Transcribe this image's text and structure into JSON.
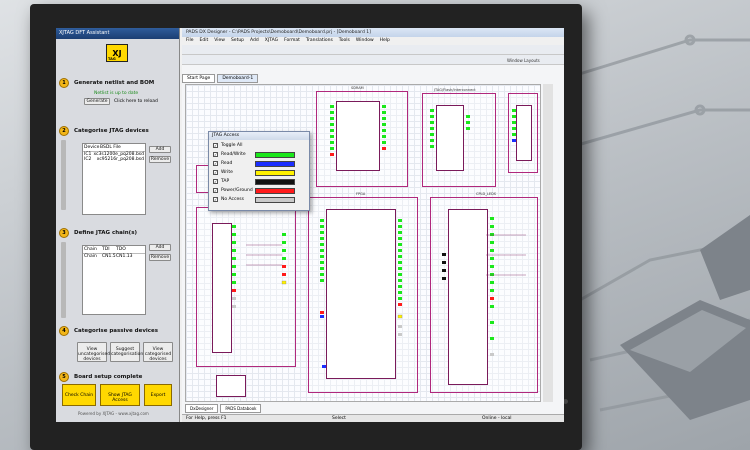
{
  "assistant": {
    "title": "XJTAG DFT Assistant",
    "logo_top": "XJ",
    "logo_bottom": "TAG",
    "steps": [
      {
        "num": "1",
        "title": "Generate netlist and BOM",
        "status": "Netlist is up to date",
        "button": "Generate",
        "hint": "Click here to reload"
      },
      {
        "num": "2",
        "title": "Categorise JTAG devices",
        "col1": "Device",
        "col2": "BSDL File",
        "rows": [
          [
            "IC1",
            "xc3s1200e_pq208.bsd"
          ],
          [
            "IC2",
            "xc95216r_pq208.bsd"
          ]
        ],
        "add": "Add",
        "remove": "Remove"
      },
      {
        "num": "3",
        "title": "Define JTAG chain(s)",
        "col1": "Chain",
        "col2": "TDI",
        "col3": "TDO",
        "rows": [
          [
            "Chain",
            "CN1.5",
            "CN1.13"
          ]
        ],
        "add": "Add",
        "remove": "Remove"
      },
      {
        "num": "4",
        "title": "Categorise passive devices",
        "b1": "View uncategorised devices",
        "b2": "Suggest categorisations",
        "b3": "View categorised devices"
      },
      {
        "num": "5",
        "title": "Board setup complete",
        "b1": "Check Chain",
        "b2": "Show JTAG Access",
        "b3": "Export"
      }
    ],
    "footer": "Powered by XJTAG - www.xjtag.com"
  },
  "pads": {
    "title": "PADS DX Designer - C:\\PADS Projects\\Demoboard\\Demoboard.prj - [Demoboard 1]",
    "menu": [
      "File",
      "Edit",
      "View",
      "Setup",
      "Add",
      "XJTAG",
      "Format",
      "Translations",
      "Tools",
      "Window",
      "Help"
    ],
    "tabs": [
      "Start Page",
      "Demoboard-1"
    ],
    "bottom_tabs": [
      "DxDesigner",
      "PADS Databook"
    ],
    "status_left": "For Help, press F1",
    "status_mid": "Select",
    "status_right": "Online - local",
    "side_label": "Window Layouts"
  },
  "jtag_access": {
    "title": "JTAG Access",
    "items": [
      {
        "label": "Toggle All",
        "color": null
      },
      {
        "label": "Read/Write",
        "color": "#1be81b"
      },
      {
        "label": "Read",
        "color": "#1a2dff"
      },
      {
        "label": "Write",
        "color": "#fff100"
      },
      {
        "label": "TAP",
        "color": "#111111"
      },
      {
        "label": "Power/Ground",
        "color": "#ff1a1a"
      },
      {
        "label": "No Access",
        "color": "#c9c9c9"
      }
    ]
  },
  "schematic": {
    "labels": [
      "SDRAM",
      "JTAG/Flash/Interconnect",
      "FLASH",
      "Unit",
      "FPGA",
      "CPLD_LEDS",
      "CONNECTOR"
    ]
  }
}
